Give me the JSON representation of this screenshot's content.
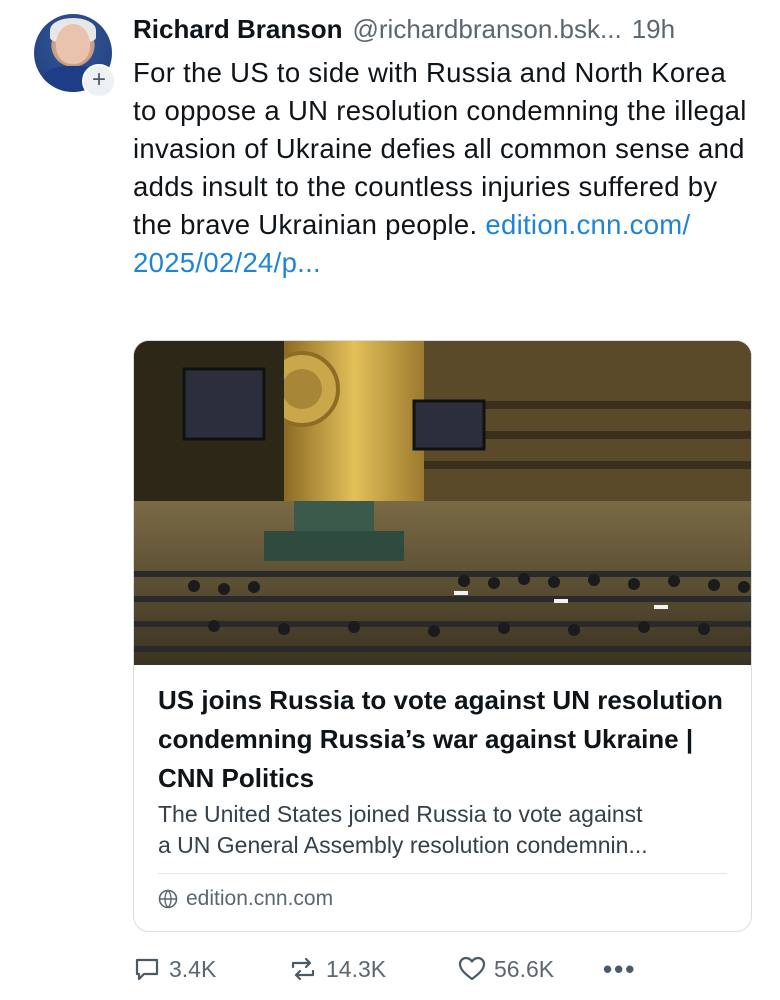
{
  "post": {
    "author_name": "Richard Branson",
    "author_handle": "@richardbranson.bsk...",
    "time_ago": "19h",
    "text": "For the US to side with Russia and North Korea to oppose a UN resolution condemning the illegal invasion of Ukraine defies all common sense and adds insult to the countless injuries suffered by the brave Ukrainian people.",
    "link_text": "edition.cnn.com/ 2025/02/24/p...",
    "follow_icon": "plus-icon"
  },
  "card": {
    "title": "US joins Russia to vote against UN resolution condemning Russia’s war against Ukraine | CNN Politics",
    "description_line1": "The United States joined Russia to vote against",
    "description_line2": "a UN General Assembly resolution condemnin...",
    "domain": "edition.cnn.com",
    "domain_icon": "globe-icon",
    "image": "un-general-assembly-photo"
  },
  "actions": {
    "replies": "3.4K",
    "reposts": "14.3K",
    "likes": "56.6K",
    "more_label": "•••"
  },
  "colors": {
    "link": "#1d84d8",
    "text": "#0f1419",
    "muted": "#5b6770",
    "border": "#d9dee3"
  }
}
